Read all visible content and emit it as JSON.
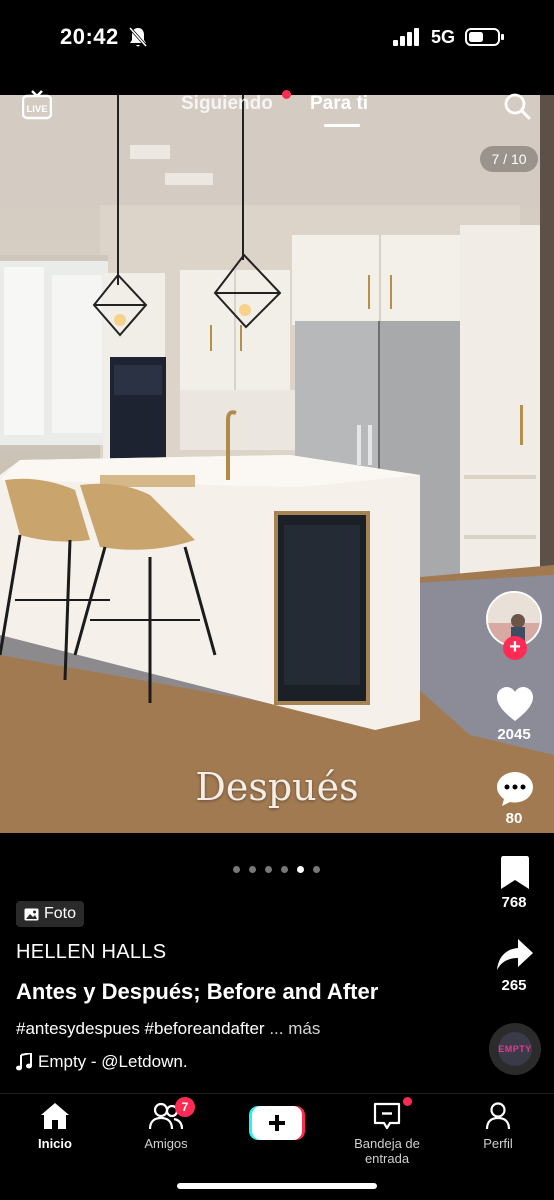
{
  "status_bar": {
    "time": "20:42",
    "network": "5G"
  },
  "top_nav": {
    "live_label": "LIVE",
    "tabs": [
      {
        "label": "Siguiendo",
        "active": false,
        "has_notification": true
      },
      {
        "label": "Para ti",
        "active": true
      }
    ],
    "search_icon": "search-icon"
  },
  "photo": {
    "counter": "7 / 10",
    "caption": "Después",
    "carousel": {
      "total": 6,
      "active_index": 4
    }
  },
  "actions": {
    "likes": "2045",
    "comments": "80",
    "bookmarks": "768",
    "shares": "265"
  },
  "post": {
    "type_badge": "Foto",
    "author": "HELLEN HALLS",
    "title": "Antes y Después; Before and After",
    "hashtags": "#antesydespues #beforeandafter",
    "more": "... más",
    "sound": "Empty - @Letdown.",
    "music_disc_label": "EMPTY"
  },
  "bottom_nav": {
    "items": [
      {
        "label": "Inicio",
        "icon": "home-icon",
        "active": true
      },
      {
        "label": "Amigos",
        "icon": "friends-icon",
        "badge": "7"
      },
      {
        "label": "",
        "icon": "create-icon"
      },
      {
        "label": "Bandeja de entrada",
        "icon": "inbox-icon",
        "has_notification": true
      },
      {
        "label": "Perfil",
        "icon": "profile-icon"
      }
    ]
  },
  "colors": {
    "accent": "#fe2c55",
    "background": "#000000"
  }
}
